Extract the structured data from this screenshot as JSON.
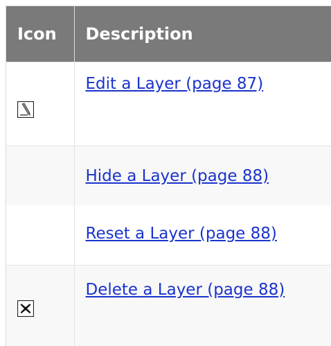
{
  "table": {
    "headers": {
      "icon": "Icon",
      "description": "Description"
    },
    "rows": [
      {
        "icon": "pencil-edit-icon",
        "label": "Edit a Layer (page 87)"
      },
      {
        "icon": "",
        "label": "Hide a Layer (page 88)"
      },
      {
        "icon": "",
        "label": "Reset a Layer (page 88)"
      },
      {
        "icon": "delete-x-icon",
        "label": "Delete a Layer (page 88)"
      }
    ]
  },
  "colors": {
    "header_background": "#7a7a7a",
    "header_text": "#ffffff",
    "link": "#1a33cc",
    "row_shade": "#f8f8f8",
    "border": "#d9d9d9"
  }
}
